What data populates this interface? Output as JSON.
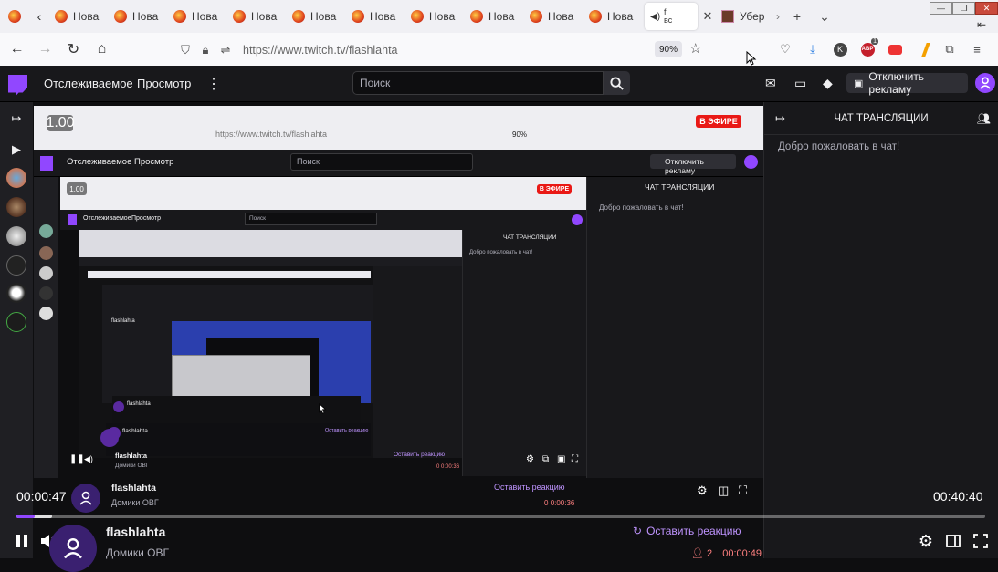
{
  "browser": {
    "tab_title": "Нова",
    "active_tab_title": "fl",
    "active_tab_sub": "вс",
    "last_tab_title": "Убер",
    "url": "https://www.twitch.tv/flashlahta",
    "zoom": "90%",
    "ext_badge": "1",
    "ext_k": "K",
    "ext_abp": "ABP"
  },
  "twitch": {
    "nav_following": "Отслеживаемое",
    "nav_browse": "Просмотр",
    "search_placeholder": "Поиск",
    "disable_ads": "Отключить рекламу"
  },
  "chat": {
    "header": "ЧАТ ТРАНСЛЯЦИИ",
    "welcome": "Добро пожаловать в чат!"
  },
  "nested": {
    "live": "В ЭФИРЕ",
    "speed": "1.00",
    "url": "https://www.twitch.tv/flashlahta",
    "zoom": "90%"
  },
  "player": {
    "current_time": "00:00:47",
    "duration": "00:40:40",
    "progress_fraction": 0.019,
    "buffered_fraction": 0.037,
    "streamer_name": "flashlahta",
    "game": "Домики ОВГ",
    "react": "Оставить реакцию",
    "viewers": "2",
    "uptime": "00:00:49",
    "inner_uptime": "0:00:36",
    "inner_viewers": "0"
  },
  "colors": {
    "twitch_purple": "#9147ff",
    "live_red": "#e91916"
  }
}
